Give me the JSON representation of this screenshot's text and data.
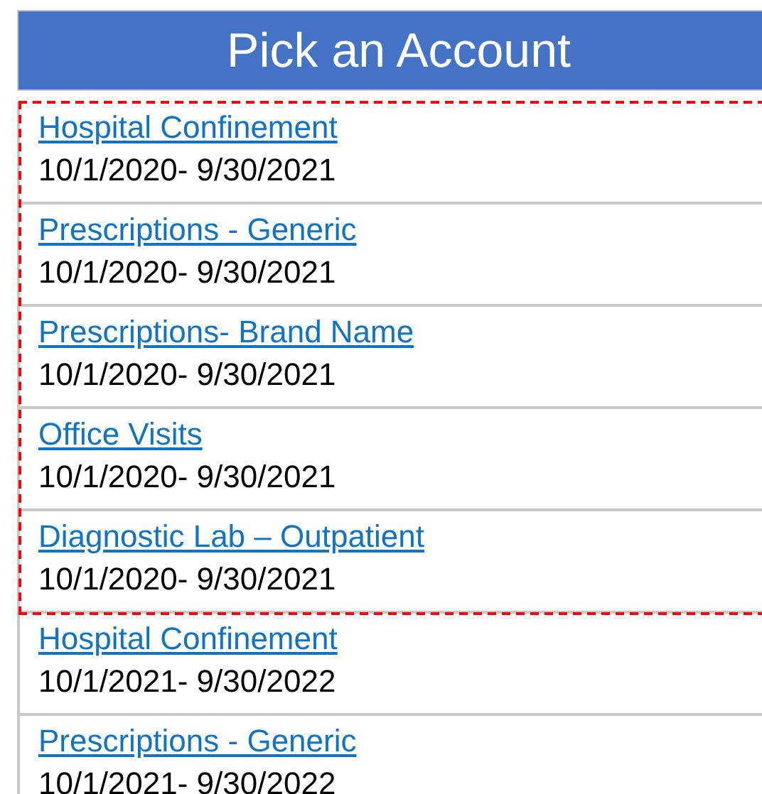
{
  "header": {
    "title": "Pick an Account"
  },
  "groups": [
    {
      "highlighted": true,
      "accounts": [
        {
          "name": "Hospital Confinement",
          "period": "10/1/2020- 9/30/2021"
        },
        {
          "name": "Prescriptions - Generic",
          "period": "10/1/2020- 9/30/2021"
        },
        {
          "name": "Prescriptions- Brand Name",
          "period": "10/1/2020- 9/30/2021"
        },
        {
          "name": "Office Visits",
          "period": "10/1/2020- 9/30/2021"
        },
        {
          "name": "Diagnostic Lab – Outpatient",
          "period": "10/1/2020- 9/30/2021"
        }
      ]
    },
    {
      "highlighted": false,
      "accounts": [
        {
          "name": "Hospital Confinement",
          "period": "10/1/2021- 9/30/2022"
        },
        {
          "name": "Prescriptions - Generic",
          "period": "10/1/2021- 9/30/2022"
        }
      ]
    }
  ]
}
